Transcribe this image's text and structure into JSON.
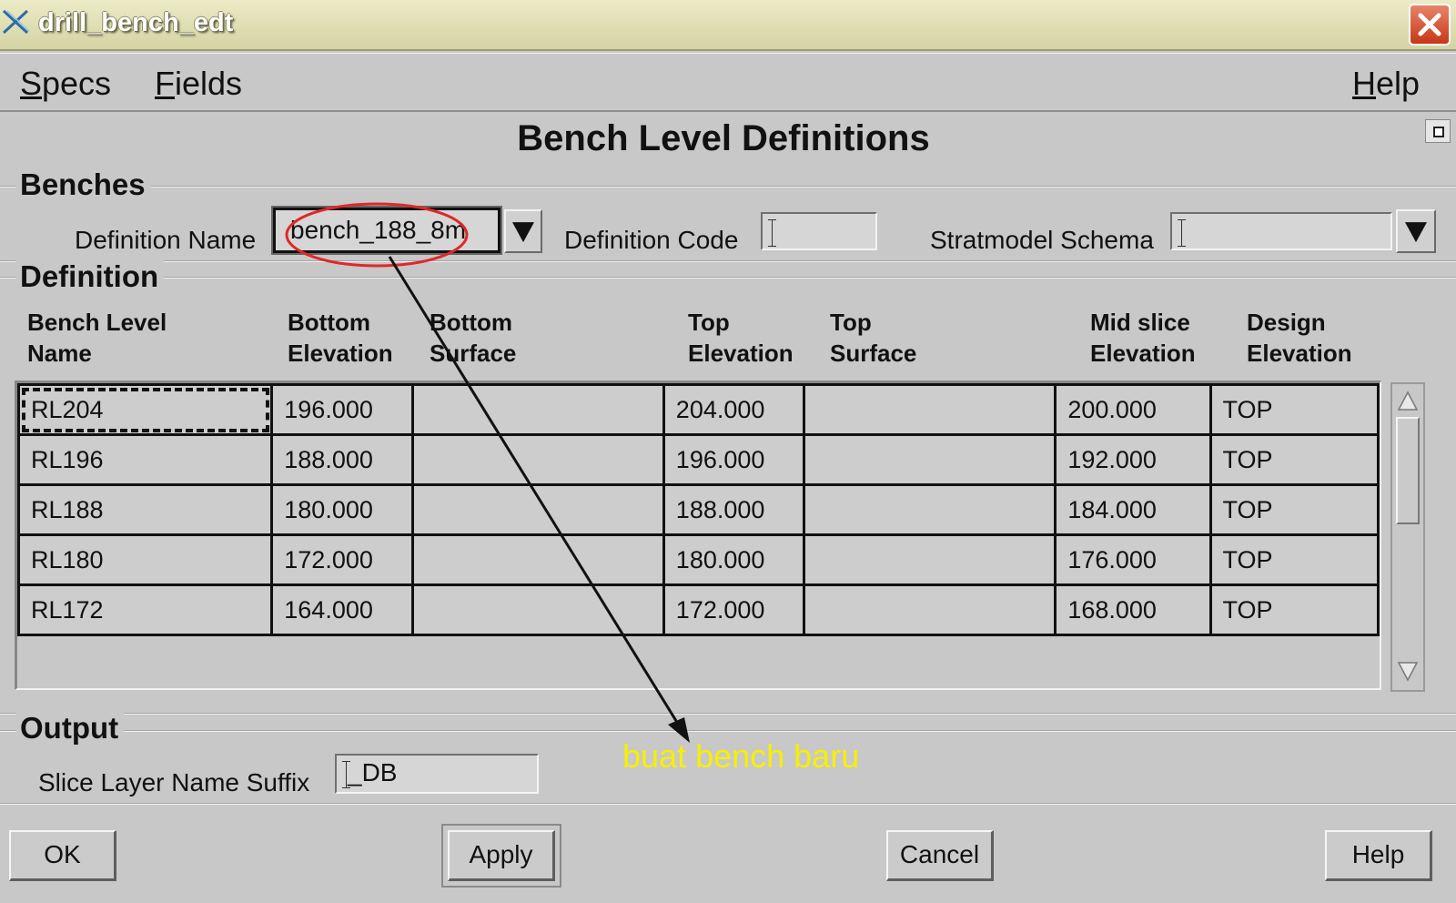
{
  "window": {
    "title": "drill_bench_edt"
  },
  "menu": {
    "specs": "Specs",
    "fields": "Fields",
    "help": "Help"
  },
  "page_title": "Bench Level Definitions",
  "benches": {
    "section": "Benches",
    "definition_name_label": "Definition Name",
    "definition_name_value": "bench_188_8m",
    "definition_code_label": "Definition Code",
    "definition_code_value": "",
    "stratmodel_schema_label": "Stratmodel Schema",
    "stratmodel_schema_value": ""
  },
  "definition": {
    "section": "Definition",
    "columns": [
      [
        "Bench Level",
        "Name"
      ],
      [
        "Bottom",
        "Elevation"
      ],
      [
        "Bottom",
        "Surface"
      ],
      [
        "Top",
        "Elevation"
      ],
      [
        "Top",
        "Surface"
      ],
      [
        "Mid slice",
        "Elevation"
      ],
      [
        "Design",
        "Elevation"
      ]
    ],
    "rows": [
      [
        "RL204",
        "196.000",
        "",
        "204.000",
        "",
        "200.000",
        "TOP"
      ],
      [
        "RL196",
        "188.000",
        "",
        "196.000",
        "",
        "192.000",
        "TOP"
      ],
      [
        "RL188",
        "180.000",
        "",
        "188.000",
        "",
        "184.000",
        "TOP"
      ],
      [
        "RL180",
        "172.000",
        "",
        "180.000",
        "",
        "176.000",
        "TOP"
      ],
      [
        "RL172",
        "164.000",
        "",
        "172.000",
        "",
        "168.000",
        "TOP"
      ]
    ]
  },
  "output": {
    "section": "Output",
    "suffix_label": "Slice Layer Name Suffix",
    "suffix_value": "_DB"
  },
  "buttons": {
    "ok": "OK",
    "apply": "Apply",
    "cancel": "Cancel",
    "help": "Help"
  },
  "annotation": {
    "text": "buat bench baru",
    "color": "#f6f000",
    "circle_color": "#e02828"
  },
  "colors": {
    "background": "#c8c8c8",
    "title_bar": "#e2e1b6",
    "close": "#d24a2a"
  },
  "icons": {
    "app": "x-logo-icon",
    "close": "close-icon",
    "dropdown": "triangle-down-icon"
  }
}
